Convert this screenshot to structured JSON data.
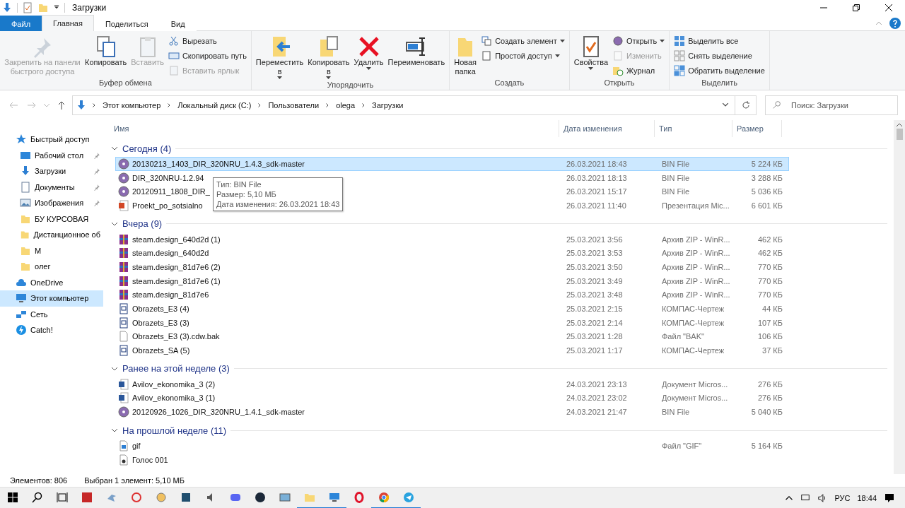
{
  "window": {
    "title": "Загрузки"
  },
  "ribbon_tabs": [
    {
      "label": "Файл",
      "kind": "file",
      "selected": false
    },
    {
      "label": "Главная",
      "kind": "tab",
      "selected": true
    },
    {
      "label": "Поделиться",
      "kind": "tab",
      "selected": false
    },
    {
      "label": "Вид",
      "kind": "tab",
      "selected": false
    }
  ],
  "ribbon_groups": [
    {
      "title": "Буфер обмена",
      "items": [
        {
          "label": "Закрепить на панели быстрого доступа",
          "kind": "big",
          "disabled": true,
          "dropdown": false
        },
        {
          "label": "Копировать",
          "kind": "big",
          "disabled": false,
          "dropdown": false
        },
        {
          "label": "Вставить",
          "kind": "big",
          "disabled": true,
          "dropdown": false
        },
        {
          "label": "Вырезать",
          "kind": "small",
          "disabled": false,
          "dropdown": false
        },
        {
          "label": "Скопировать путь",
          "kind": "small",
          "disabled": false,
          "dropdown": false
        },
        {
          "label": "Вставить ярлык",
          "kind": "small",
          "disabled": true,
          "dropdown": false
        }
      ]
    },
    {
      "title": "Упорядочить",
      "items": [
        {
          "label": "Переместить\nв",
          "kind": "big",
          "disabled": false,
          "dropdown": true
        },
        {
          "label": "Копировать\nв",
          "kind": "big",
          "disabled": false,
          "dropdown": true
        },
        {
          "label": "Удалить",
          "kind": "big",
          "disabled": false,
          "dropdown": true
        },
        {
          "label": "Переименовать",
          "kind": "big",
          "disabled": false,
          "dropdown": false
        }
      ]
    },
    {
      "title": "Создать",
      "items": [
        {
          "label": "Новая\nпапка",
          "kind": "big",
          "disabled": false,
          "dropdown": false
        },
        {
          "label": "Создать элемент",
          "kind": "small",
          "disabled": false,
          "dropdown": true
        },
        {
          "label": "Простой доступ",
          "kind": "small",
          "disabled": false,
          "dropdown": true
        }
      ]
    },
    {
      "title": "Открыть",
      "items": [
        {
          "label": "Свойства",
          "kind": "big",
          "disabled": false,
          "dropdown": true
        },
        {
          "label": "Открыть",
          "kind": "small",
          "disabled": false,
          "dropdown": true
        },
        {
          "label": "Изменить",
          "kind": "small",
          "disabled": true,
          "dropdown": false
        },
        {
          "label": "Журнал",
          "kind": "small",
          "disabled": false,
          "dropdown": false
        }
      ]
    },
    {
      "title": "Выделить",
      "items": [
        {
          "label": "Выделить все",
          "kind": "small",
          "disabled": false,
          "dropdown": false
        },
        {
          "label": "Снять выделение",
          "kind": "small",
          "disabled": false,
          "dropdown": false
        },
        {
          "label": "Обратить выделение",
          "kind": "small",
          "disabled": false,
          "dropdown": false
        }
      ]
    }
  ],
  "address_bar": {
    "path": [
      "Этот компьютер",
      "Локальный диск (C:)",
      "Пользователи",
      "olega",
      "Загрузки"
    ]
  },
  "search": {
    "placeholder": "Поиск: Загрузки"
  },
  "navigation": [
    {
      "label": "Быстрый доступ",
      "kind": "star",
      "pinned": false,
      "selected": false
    },
    {
      "label": "Рабочий стол",
      "kind": "desktop",
      "pinned": true,
      "selected": false
    },
    {
      "label": "Загрузки",
      "kind": "download",
      "pinned": true,
      "selected": false
    },
    {
      "label": "Документы",
      "kind": "docs",
      "pinned": true,
      "selected": false
    },
    {
      "label": "Изображения",
      "kind": "images",
      "pinned": true,
      "selected": false
    },
    {
      "label": "БУ КУРСОВАЯ",
      "kind": "folder",
      "pinned": false,
      "selected": false
    },
    {
      "label": "Дистанционное об",
      "kind": "folder",
      "pinned": false,
      "selected": false
    },
    {
      "label": "M",
      "kind": "folder",
      "pinned": false,
      "selected": false
    },
    {
      "label": "олег",
      "kind": "folder",
      "pinned": false,
      "selected": false
    },
    {
      "label": "OneDrive",
      "kind": "cloud",
      "pinned": false,
      "selected": false
    },
    {
      "label": "Этот компьютер",
      "kind": "pc",
      "pinned": false,
      "selected": true
    },
    {
      "label": "Сеть",
      "kind": "network",
      "pinned": false,
      "selected": false
    },
    {
      "label": "Catch!",
      "kind": "catch",
      "pinned": false,
      "selected": false
    }
  ],
  "columns": [
    "Имя",
    "Дата изменения",
    "Тип",
    "Размер"
  ],
  "groups": [
    {
      "label": "Сегодня (4)",
      "expanded": true,
      "rows": [
        {
          "name": "20130213_1403_DIR_320NRU_1.4.3_sdk-master",
          "date": "26.03.2021 18:43",
          "type": "BIN File",
          "size": "5 224 КБ",
          "kind": "bin",
          "selected": true
        },
        {
          "name": "DIR_320NRU-1.2.94",
          "date": "26.03.2021 18:13",
          "type": "BIN File",
          "size": "3 288 КБ",
          "kind": "bin",
          "selected": false
        },
        {
          "name": "20120911_1808_DIR_",
          "date": "26.03.2021 15:17",
          "type": "BIN File",
          "size": "5 036 КБ",
          "kind": "bin",
          "selected": false
        },
        {
          "name": "Proekt_po_sotsialno",
          "date": "26.03.2021 11:40",
          "type": "Презентация Mic...",
          "size": "6 601 КБ",
          "kind": "pptx",
          "selected": false
        }
      ]
    },
    {
      "label": "Вчера (9)",
      "expanded": true,
      "rows": [
        {
          "name": "steam.design_640d2d (1)",
          "date": "25.03.2021 3:56",
          "type": "Архив ZIP - WinR...",
          "size": "462 КБ",
          "kind": "zip",
          "selected": false
        },
        {
          "name": "steam.design_640d2d",
          "date": "25.03.2021 3:53",
          "type": "Архив ZIP - WinR...",
          "size": "462 КБ",
          "kind": "zip",
          "selected": false
        },
        {
          "name": "steam.design_81d7e6 (2)",
          "date": "25.03.2021 3:50",
          "type": "Архив ZIP - WinR...",
          "size": "770 КБ",
          "kind": "zip",
          "selected": false
        },
        {
          "name": "steam.design_81d7e6 (1)",
          "date": "25.03.2021 3:49",
          "type": "Архив ZIP - WinR...",
          "size": "770 КБ",
          "kind": "zip",
          "selected": false
        },
        {
          "name": "steam.design_81d7e6",
          "date": "25.03.2021 3:48",
          "type": "Архив ZIP - WinR...",
          "size": "770 КБ",
          "kind": "zip",
          "selected": false
        },
        {
          "name": "Obrazets_E3 (4)",
          "date": "25.03.2021 2:15",
          "type": "КОМПАС-Чертеж",
          "size": "44 КБ",
          "kind": "kompas",
          "selected": false
        },
        {
          "name": "Obrazets_E3 (3)",
          "date": "25.03.2021 2:14",
          "type": "КОМПАС-Чертеж",
          "size": "107 КБ",
          "kind": "kompas",
          "selected": false
        },
        {
          "name": "Obrazets_E3 (3).cdw.bak",
          "date": "25.03.2021 1:28",
          "type": "Файл \"BAK\"",
          "size": "106 КБ",
          "kind": "blank",
          "selected": false
        },
        {
          "name": "Obrazets_SA (5)",
          "date": "25.03.2021 1:17",
          "type": "КОМПАС-Чертеж",
          "size": "37 КБ",
          "kind": "kompas",
          "selected": false
        }
      ]
    },
    {
      "label": "Ранее на этой неделе (3)",
      "expanded": true,
      "rows": [
        {
          "name": "Avilov_ekonomika_3 (2)",
          "date": "24.03.2021 23:13",
          "type": "Документ Micros...",
          "size": "276 КБ",
          "kind": "word",
          "selected": false
        },
        {
          "name": "Avilov_ekonomika_3 (1)",
          "date": "24.03.2021 23:02",
          "type": "Документ Micros...",
          "size": "276 КБ",
          "kind": "word",
          "selected": false
        },
        {
          "name": "20120926_1026_DIR_320NRU_1.4.1_sdk-master",
          "date": "24.03.2021 21:47",
          "type": "BIN File",
          "size": "5 040 КБ",
          "kind": "bin",
          "selected": false
        }
      ]
    },
    {
      "label": "На прошлой неделе (11)",
      "expanded": true,
      "rows": [
        {
          "name": "gif",
          "type": "Файл \"GIF\"",
          "size": "5 164 КБ",
          "kind": "gif",
          "selected": false
        },
        {
          "name": "Голос 001",
          "kind": "audio",
          "selected": false
        }
      ]
    }
  ],
  "tooltip": [
    "Тип: BIN File",
    "Размер: 5,10 МБ",
    "Дата изменения: 26.03.2021 18:43"
  ],
  "status_bar": {
    "items": "Элементов: 806",
    "selection": "Выбран 1 элемент: 5,10 МБ"
  },
  "taskbar": {
    "apps": [
      {
        "kind": "aida",
        "open": false
      },
      {
        "kind": "bird",
        "open": false
      },
      {
        "kind": "paint",
        "open": false
      },
      {
        "kind": "palette",
        "open": false
      },
      {
        "kind": "chip",
        "open": false
      },
      {
        "kind": "speaker",
        "open": false
      },
      {
        "kind": "discord",
        "open": false
      },
      {
        "kind": "steam",
        "open": false
      },
      {
        "kind": "image",
        "open": false
      },
      {
        "kind": "explorer",
        "open": true
      },
      {
        "kind": "monitor",
        "open": true
      },
      {
        "kind": "opera",
        "open": false
      },
      {
        "kind": "chrome",
        "open": true
      },
      {
        "kind": "telegram",
        "open": true
      }
    ],
    "language": "РУС",
    "time": "18:44"
  }
}
